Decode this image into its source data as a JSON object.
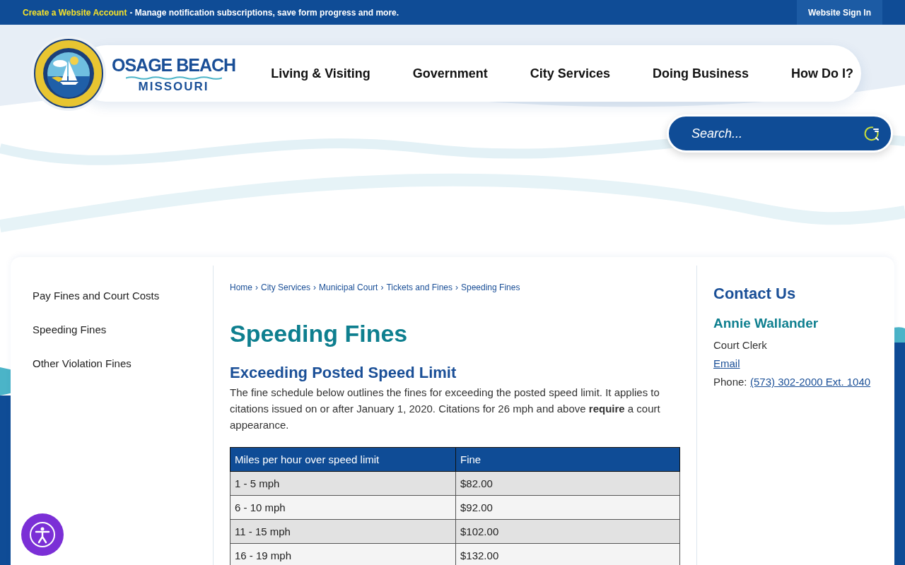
{
  "top_bar": {
    "link": "Create a Website Account",
    "message": "- Manage notification subscriptions, save form progress and more.",
    "sign_in": "Website Sign In"
  },
  "logo": {
    "name": "OSAGE BEACH",
    "state": "MISSOURI"
  },
  "nav": [
    "Living & Visiting",
    "Government",
    "City Services",
    "Doing Business",
    "How Do I?"
  ],
  "search": {
    "placeholder": "Search..."
  },
  "sidebar": {
    "items": [
      {
        "label": "Pay Fines and Court Costs",
        "selected": false
      },
      {
        "label": "Speeding Fines",
        "selected": false
      },
      {
        "label": "Other Violation Fines",
        "selected": false
      }
    ]
  },
  "breadcrumb": {
    "separator": "›",
    "items": [
      "Home",
      "City Services",
      "Municipal Court",
      "Tickets and Fines",
      "Speeding Fines"
    ]
  },
  "page_title": "Speeding Fines",
  "section": {
    "heading": "Exceeding Posted Speed Limit",
    "paragraph": "The fine schedule below outlines the fines for exceeding the posted speed limit. It applies to citations issued on or after January 1, 2020. Citations for 26 mph and above **require** a court appearance."
  },
  "table": {
    "columns": [
      "Miles per hour over speed limit",
      "Fine"
    ],
    "rows": [
      [
        "1 - 5 mph",
        "$82.00"
      ],
      [
        "6 - 10 mph",
        "$92.00"
      ],
      [
        "11 - 15 mph",
        "$102.00"
      ],
      [
        "16 - 19 mph",
        "$132.00"
      ]
    ]
  },
  "contact": {
    "heading": "Contact Us",
    "name": "Annie Wallander",
    "role": "Court Clerk",
    "email": "Email",
    "phone_label": "Phone:",
    "phone": "(573) 302-2000 Ext. 1040"
  }
}
